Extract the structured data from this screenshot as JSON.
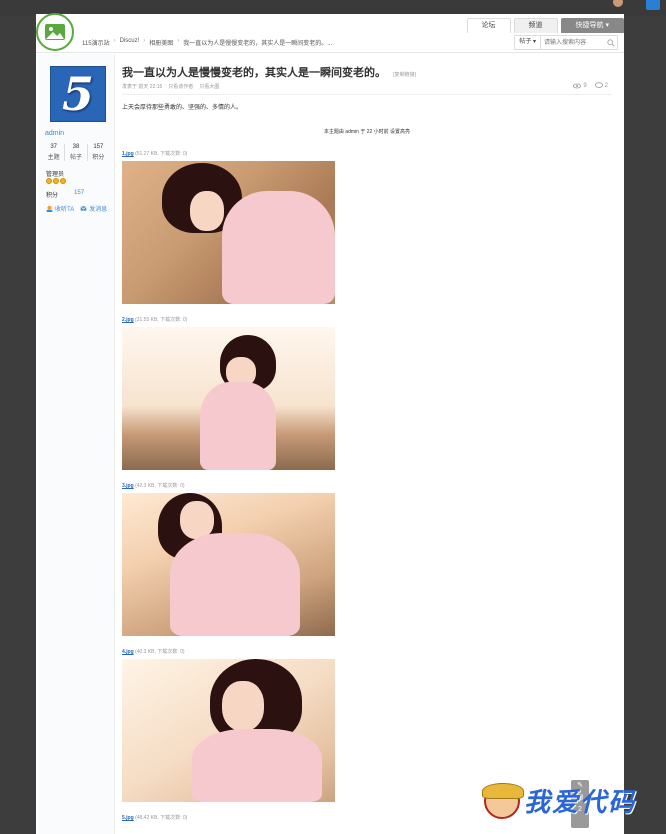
{
  "topbar": {
    "username": ""
  },
  "nav": {
    "tabs": [
      "论坛",
      "频道",
      "快捷导航 ▾"
    ]
  },
  "breadcrumb": [
    "115演示站",
    "Discuz!",
    "相册美图",
    "我一直以为人是慢慢变老的，其实人是一瞬间变老的。..."
  ],
  "search": {
    "type": "帖子 ▾",
    "placeholder": "请输入搜索内容"
  },
  "author": {
    "avatar_glyph": "5",
    "name": "admin",
    "stats": [
      {
        "value": "37",
        "label": "主题"
      },
      {
        "value": "38",
        "label": "帖子"
      },
      {
        "value": "157",
        "label": "积分"
      }
    ],
    "group": "管理员",
    "credit_label": "积分",
    "credit_value": "157",
    "follow": "收听TA",
    "message": "发消息"
  },
  "thread": {
    "title": "我一直以为人是慢慢变老的，其实人是一瞬间变老的。",
    "copy_link": "[复制链接]",
    "meta": [
      "发表于 前天 22:15",
      "只看该作者",
      "只看大图"
    ],
    "views": "9",
    "replies": "2",
    "body": "上天会厚待那些勇敢的、坚强的、多情的人。",
    "notice": "本主题由 admin 于 22 小时前 设置高亮"
  },
  "attachments": [
    {
      "name": "1.jpg",
      "info": "(51.27 KB, 下载次数: 0)"
    },
    {
      "name": "2.jpg",
      "info": "(31.55 KB, 下载次数: 0)"
    },
    {
      "name": "3.jpg",
      "info": "(42.3 KB, 下载次数: 0)"
    },
    {
      "name": "4.jpg",
      "info": "(40.3 KB, 下载次数: 0)"
    },
    {
      "name": "5.jpg",
      "info": "(48.42 KB, 下载次数: 0)"
    }
  ],
  "tools": {
    "reply_count": "2"
  },
  "watermark": {
    "text": "我爱代码"
  }
}
